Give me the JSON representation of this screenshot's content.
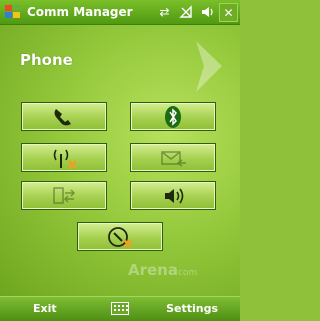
{
  "status_bar": {
    "title": "Comm Manager",
    "icons": [
      "start-flag-icon",
      "connectivity-icon",
      "signal-off-icon",
      "speaker-icon",
      "close-icon"
    ]
  },
  "page": {
    "title": "Phone"
  },
  "tiles": [
    {
      "name": "phone",
      "icon": "phone-handset-icon"
    },
    {
      "name": "bluetooth",
      "icon": "bluetooth-icon"
    },
    {
      "name": "wireless",
      "icon": "antenna-off-icon"
    },
    {
      "name": "push-mail",
      "icon": "mail-icon"
    },
    {
      "name": "activesync",
      "icon": "sync-icon"
    },
    {
      "name": "sound",
      "icon": "speaker-icon"
    },
    {
      "name": "data-connection",
      "icon": "disconnect-icon"
    }
  ],
  "watermark": {
    "brand": "Arena",
    "suffix": "com"
  },
  "soft_keys": {
    "left": "Exit",
    "right": "Settings"
  },
  "colors": {
    "accent_green": "#6ea61f",
    "status_orange": "#f0a020"
  }
}
